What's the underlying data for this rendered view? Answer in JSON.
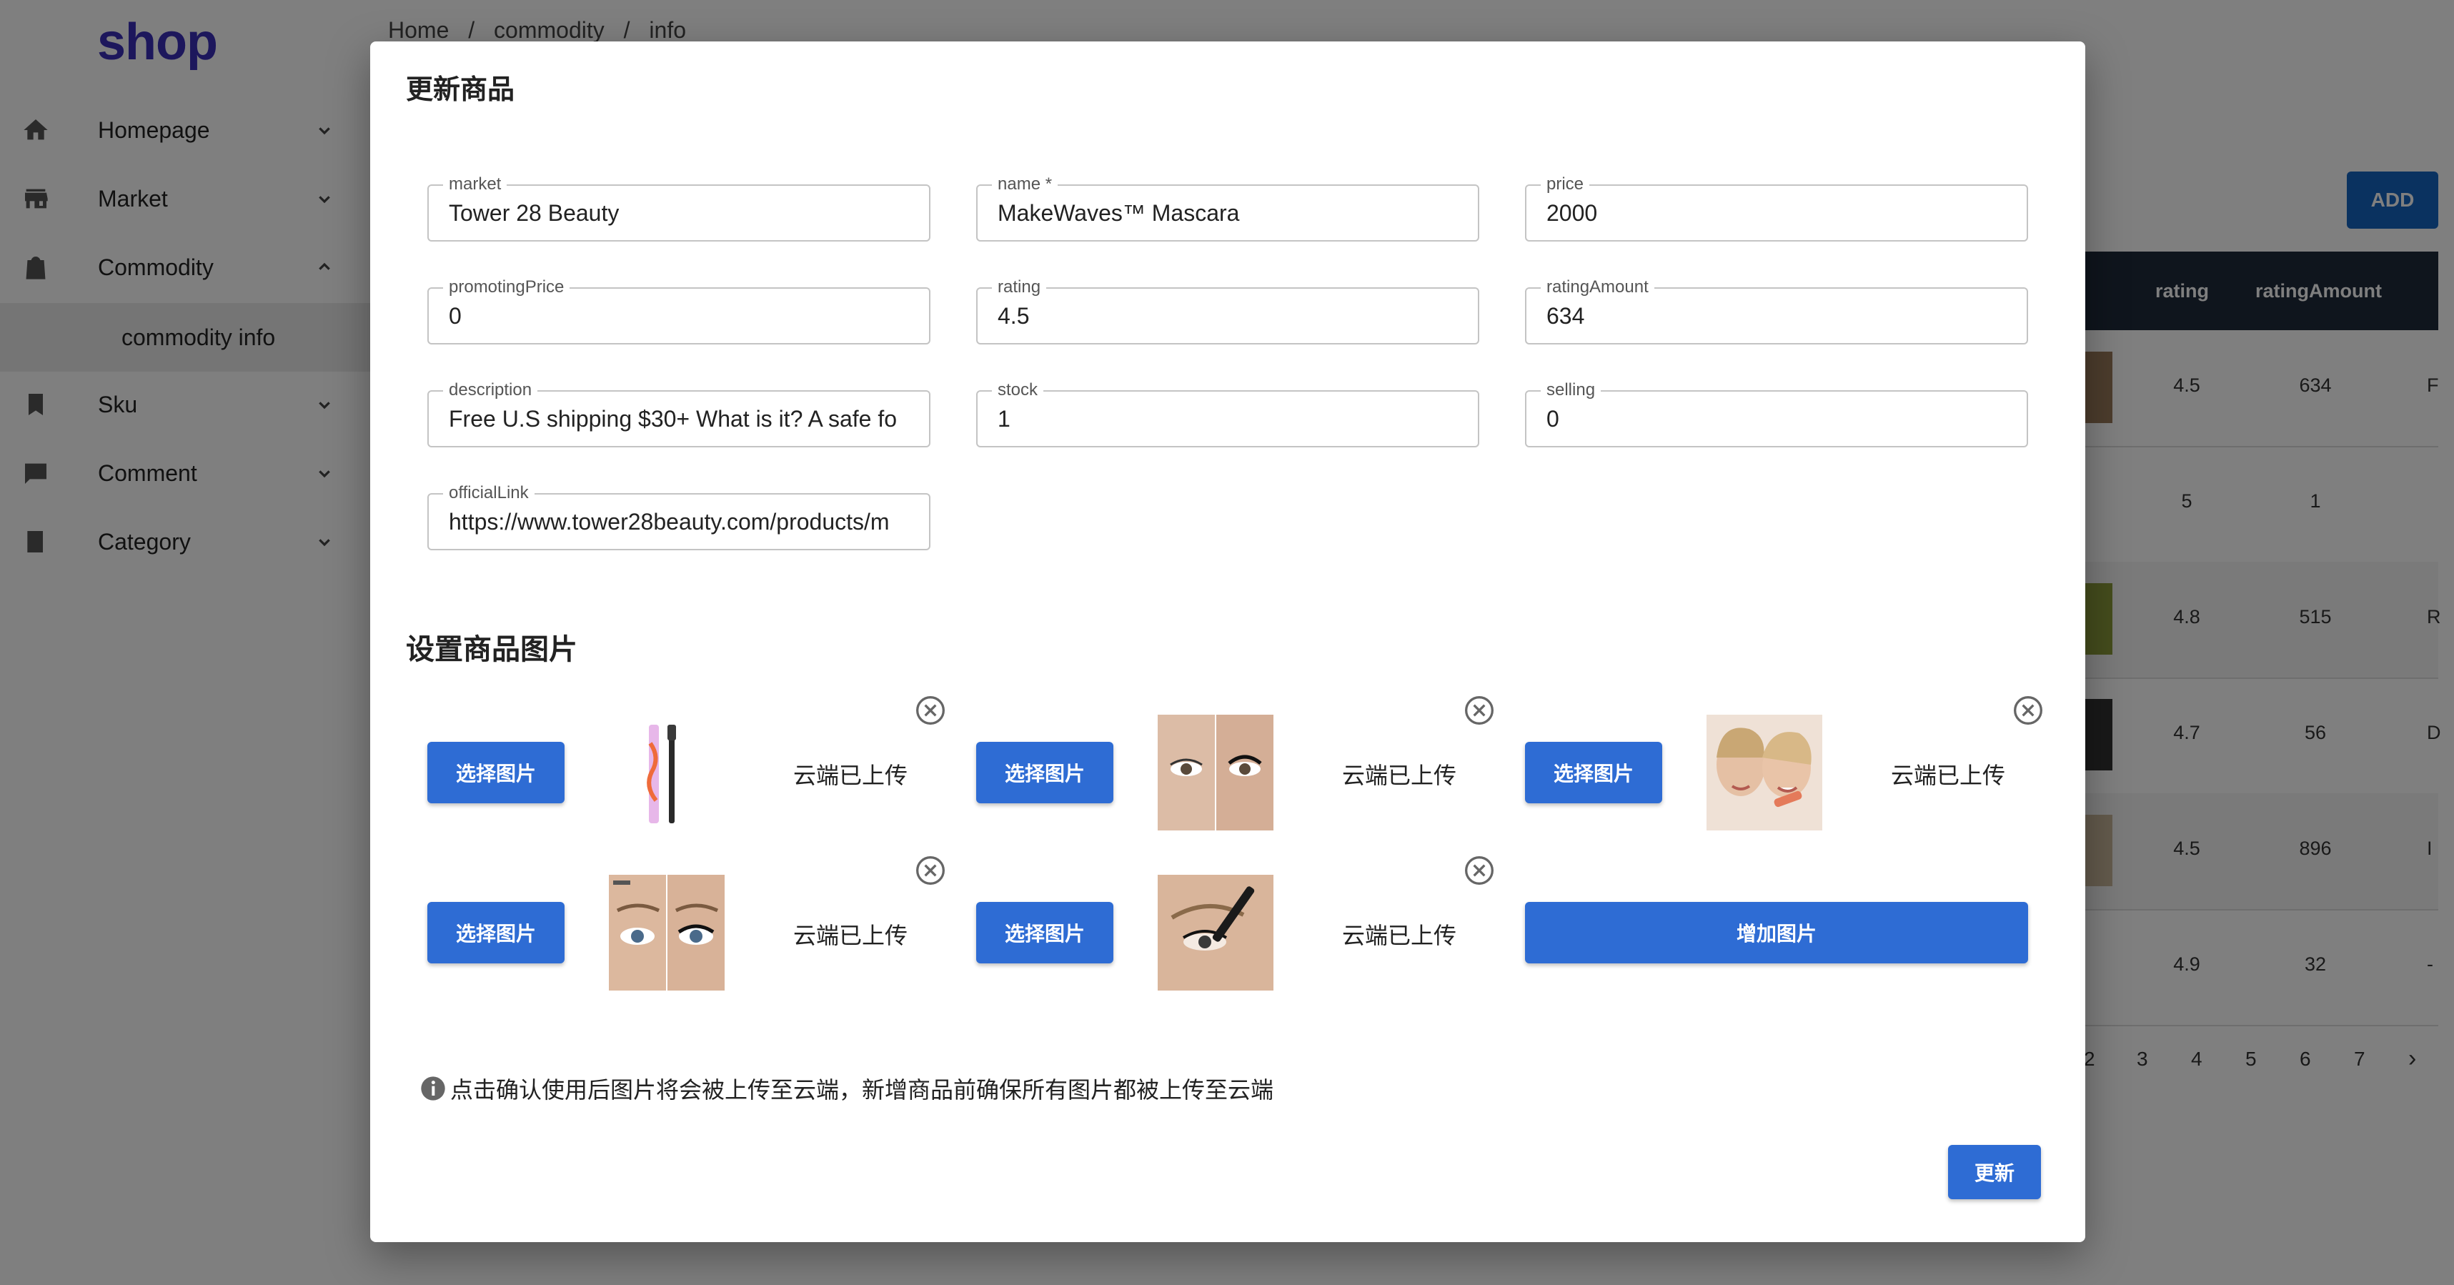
{
  "app": {
    "logo": "shop"
  },
  "breadcrumb": [
    "Home",
    "/",
    "commodity",
    "/",
    "info"
  ],
  "sidebar": {
    "items": [
      {
        "label": "Homepage",
        "icon": "home-icon"
      },
      {
        "label": "Market",
        "icon": "store-icon"
      },
      {
        "label": "Commodity",
        "icon": "bag-icon"
      },
      {
        "label": "Sku",
        "icon": "bookmark-icon"
      },
      {
        "label": "Comment",
        "icon": "comment-icon"
      },
      {
        "label": "Category",
        "icon": "book-icon"
      }
    ],
    "sub_item": "commodity info"
  },
  "toolbar": {
    "add_label": "ADD"
  },
  "table": {
    "headers": [
      "rating",
      "ratingAmount"
    ],
    "rows": [
      {
        "rating": "4.5",
        "ratingAmount": "634",
        "extra": "F"
      },
      {
        "rating": "5",
        "ratingAmount": "1",
        "extra": ""
      },
      {
        "rating": "4.8",
        "ratingAmount": "515",
        "extra": "R"
      },
      {
        "rating": "4.7",
        "ratingAmount": "56",
        "extra": "D"
      },
      {
        "rating": "4.5",
        "ratingAmount": "896",
        "extra": "I"
      },
      {
        "rating": "4.9",
        "ratingAmount": "32",
        "extra": "-"
      }
    ]
  },
  "pagination": [
    "2",
    "3",
    "4",
    "5",
    "6",
    "7",
    "›"
  ],
  "dialog": {
    "title": "更新商品",
    "fields": {
      "market": {
        "label": "market",
        "value": "Tower 28 Beauty"
      },
      "name": {
        "label": "name *",
        "value": "MakeWaves™ Mascara"
      },
      "price": {
        "label": "price",
        "value": "2000"
      },
      "promotingPrice": {
        "label": "promotingPrice",
        "value": "0"
      },
      "rating": {
        "label": "rating",
        "value": "4.5"
      },
      "ratingAmount": {
        "label": "ratingAmount",
        "value": "634"
      },
      "description": {
        "label": "description",
        "value": "Free U.S shipping $30+  What is it?  A safe fo"
      },
      "stock": {
        "label": "stock",
        "value": "1"
      },
      "selling": {
        "label": "selling",
        "value": "0"
      },
      "officialLink": {
        "label": "officialLink",
        "value": "https://www.tower28beauty.com/products/m"
      }
    },
    "images_section_title": "设置商品图片",
    "choose_image_label": "选择图片",
    "uploaded_status": "云端已上传",
    "add_image_label": "增加图片",
    "notice": "点击确认使用后图片将会被上传至云端，新增商品前确保所有图片都被上传至云端",
    "submit_label": "更新"
  }
}
